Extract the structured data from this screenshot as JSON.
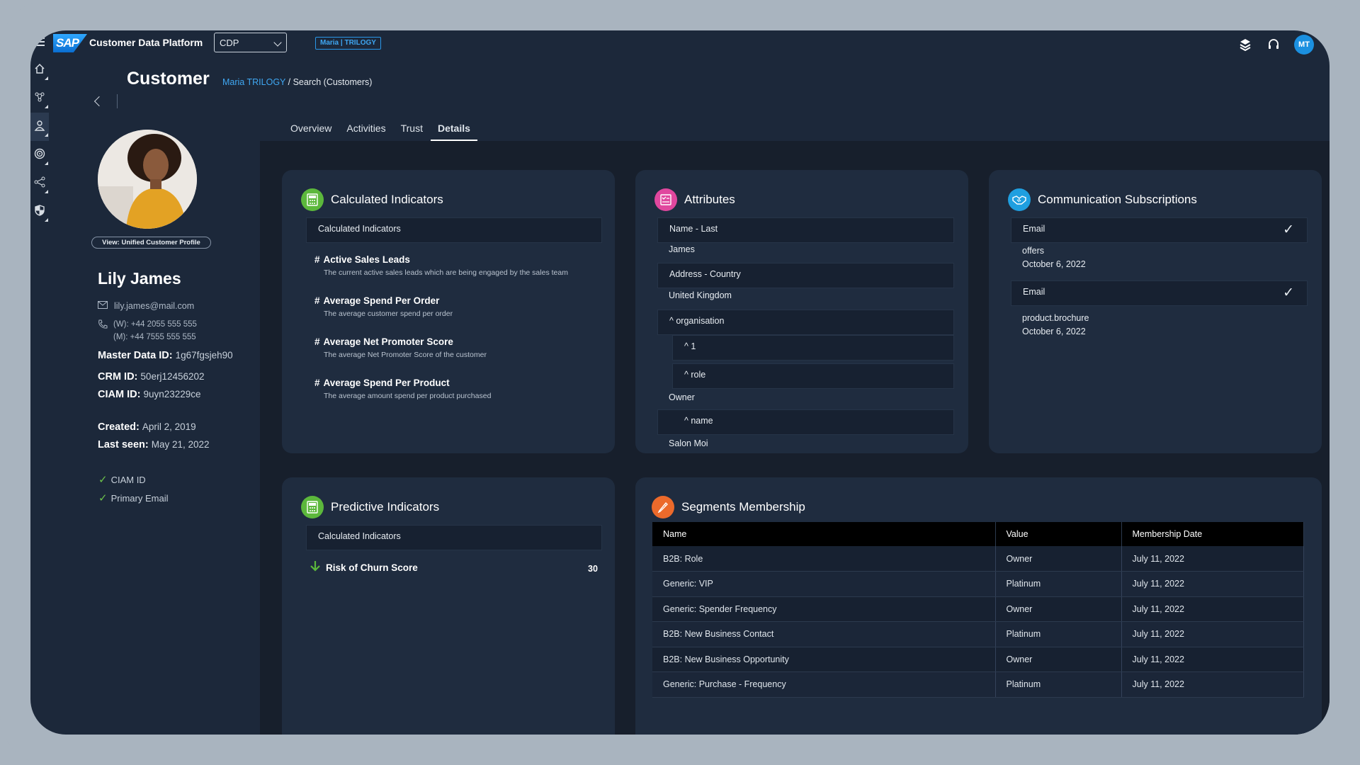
{
  "shell": {
    "logo_text": "SAP",
    "app_name": "Customer Data Platform",
    "tenant_value": "CDP",
    "context_tag": "Maria | TRILOGY",
    "user_initials": "MT"
  },
  "header": {
    "title": "Customer",
    "breadcrumb_link": "Maria TRILOGY",
    "breadcrumb_sep": " / ",
    "breadcrumb_current": "Search (Customers)"
  },
  "tabs": [
    "Overview",
    "Activities",
    "Trust",
    "Details"
  ],
  "selected_tab": "Details",
  "profile": {
    "view_label": "View: Unified Customer Profile",
    "name": "Lily James",
    "email": "lily.james@mail.com",
    "phone_work": "(W): +44 2055 555 555",
    "phone_mobile": "(M): +44 7555 555 555",
    "master_id_label": "Master Data ID:",
    "master_id": "1g67fgsjeh90",
    "crm_id_label": "CRM ID:",
    "crm_id": "50erj12456202",
    "ciam_id_label": "CIAM ID:",
    "ciam_id": "9uyn23229ce",
    "created_label": "Created:",
    "created": "April 2, 2019",
    "last_seen_label": "Last seen:",
    "last_seen": "May 21, 2022",
    "checks": [
      "CIAM ID",
      "Primary Email"
    ]
  },
  "calculated": {
    "title": "Calculated Indicators",
    "bar_label": "Calculated Indicators",
    "items": [
      {
        "title": "Active Sales Leads",
        "desc": "The current active sales leads which are being engaged by the sales team"
      },
      {
        "title": "Average Spend Per Order",
        "desc": "The average customer spend per order"
      },
      {
        "title": "Average Net Promoter Score",
        "desc": "The average Net Promoter Score of the customer"
      },
      {
        "title": "Average Spend Per Product",
        "desc": "The average amount spend per product purchased"
      }
    ]
  },
  "attributes": {
    "title": "Attributes",
    "rows": {
      "name_last_label": "Name - Last",
      "name_last_value": "James",
      "country_label": "Address - Country",
      "country_value": "United Kingdom",
      "org_label": "^ organisation",
      "org_index": "^ 1",
      "role_label": "^ role",
      "role_value": "Owner",
      "name_label": "^ name",
      "name_value": "Salon Moi"
    }
  },
  "subscriptions": {
    "title": "Communication Subscriptions",
    "items": [
      {
        "channel": "Email",
        "topic": "offers",
        "date": "October 6, 2022"
      },
      {
        "channel": "Email",
        "topic": "product.brochure",
        "date": "October 6, 2022"
      }
    ]
  },
  "predictive": {
    "title": "Predictive Indicators",
    "bar_label": "Calculated Indicators",
    "item_label": "Risk of Churn Score",
    "item_value": "30"
  },
  "segments": {
    "title": "Segments Membership",
    "columns": [
      "Name",
      "Value",
      "Membership Date"
    ],
    "rows": [
      [
        "B2B:  Role",
        "Owner",
        "July 11, 2022"
      ],
      [
        "Generic:  VIP",
        "Platinum",
        "July 11, 2022"
      ],
      [
        "Generic:  Spender Frequency",
        "Owner",
        "July 11, 2022"
      ],
      [
        "B2B:  New Business Contact",
        "Platinum",
        "July 11, 2022"
      ],
      [
        "B2B:  New Business Opportunity",
        "Owner",
        "July 11, 2022"
      ],
      [
        "Generic:  Purchase - Frequency",
        "Platinum",
        "July 11, 2022"
      ]
    ]
  },
  "colors": {
    "accent": "#3fa7f2",
    "panel": "#1f2c3f",
    "background": "#1c283a",
    "check_green": "#6cc24a"
  },
  "icons": [
    "menu-icon",
    "home-icon",
    "network-icon",
    "user-icon",
    "target-icon",
    "share-icon",
    "shield-icon",
    "layers-icon",
    "headset-icon",
    "calculator-icon",
    "form-icon",
    "handshake-icon",
    "pencil-icon",
    "arrow-down-icon",
    "mail-icon",
    "phone-icon",
    "checkmark-icon"
  ]
}
